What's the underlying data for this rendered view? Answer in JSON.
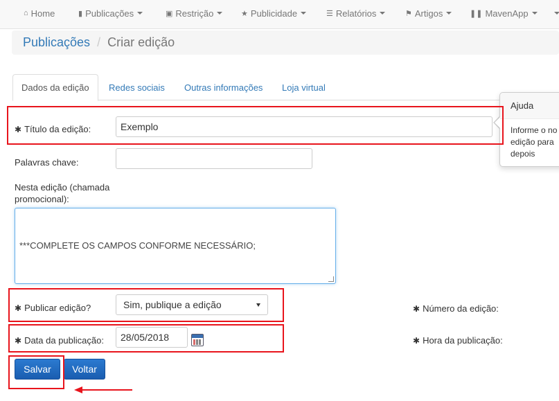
{
  "navbar": {
    "items": [
      {
        "label": "Home",
        "icon": "home-icon"
      },
      {
        "label": "Publicações",
        "icon": "file-icon"
      },
      {
        "label": "Restrição",
        "icon": "lock-icon"
      },
      {
        "label": "Publicidade",
        "icon": "star-icon"
      },
      {
        "label": "Relatórios",
        "icon": "list-icon"
      },
      {
        "label": "Artigos",
        "icon": "bookmark-icon"
      },
      {
        "label": "MavenApp",
        "icon": "barcode-icon"
      }
    ]
  },
  "breadcrumb": {
    "parent": "Publicações",
    "separator": "/",
    "current": "Criar edição"
  },
  "tabs": [
    {
      "label": "Dados da edição",
      "active": true
    },
    {
      "label": "Redes sociais",
      "active": false
    },
    {
      "label": "Outras informações",
      "active": false
    },
    {
      "label": "Loja virtual",
      "active": false
    }
  ],
  "form": {
    "required_mark": "✱",
    "titulo": {
      "label": "Título da edição:",
      "value": "Exemplo"
    },
    "palavras": {
      "label": "Palavras chave:",
      "value": ""
    },
    "chamada": {
      "label_line1": "Nesta edição (chamada",
      "label_line2": "promocional):",
      "value": "***COMPLETE OS CAMPOS CONFORME NECESSÁRIO;"
    },
    "publicar": {
      "label": "Publicar edição?",
      "value": "Sim, publique a edição"
    },
    "numero": {
      "label": "Número da edição:"
    },
    "data": {
      "label": "Data da publicação:",
      "value": "28/05/2018"
    },
    "hora": {
      "label": "Hora da publicação:"
    }
  },
  "buttons": {
    "save": "Salvar",
    "back": "Voltar"
  },
  "help": {
    "title": "Ajuda",
    "body": "Informe o no\nedição para\ndepois"
  },
  "colors": {
    "annotation": "#e8141c",
    "primary": "#337ab7",
    "button": "#1a5db0"
  }
}
